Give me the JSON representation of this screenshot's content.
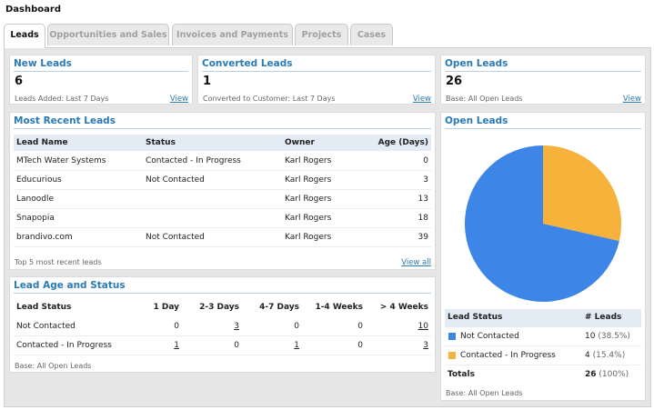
{
  "app": {
    "title": "Dashboard"
  },
  "tabs": [
    {
      "label": "Leads",
      "active": true
    },
    {
      "label": "Opportunities and Sales",
      "active": false
    },
    {
      "label": "Invoices and Payments",
      "active": false
    },
    {
      "label": "Projects",
      "active": false
    },
    {
      "label": "Cases",
      "active": false
    }
  ],
  "kpis": {
    "new_leads": {
      "title": "New Leads",
      "value": "6",
      "note": "Leads Added: Last 7 Days",
      "link": "View"
    },
    "converted_leads": {
      "title": "Converted Leads",
      "value": "1",
      "note": "Converted to Customer: Last 7 Days",
      "link": "View"
    },
    "open_leads": {
      "title": "Open Leads",
      "value": "26",
      "note": "Base: All Open Leads",
      "link": "View"
    }
  },
  "recent": {
    "title": "Most Recent Leads",
    "columns": {
      "name": "Lead Name",
      "status": "Status",
      "owner": "Owner",
      "age": "Age (Days)"
    },
    "rows": [
      {
        "name": "MTech Water Systems",
        "status": "Contacted - In Progress",
        "owner": "Karl Rogers",
        "age": "0"
      },
      {
        "name": "Educurious",
        "status": "Not Contacted",
        "owner": "Karl Rogers",
        "age": "3"
      },
      {
        "name": "Lanoodle",
        "status": "",
        "owner": "Karl Rogers",
        "age": "13"
      },
      {
        "name": "Snapopia",
        "status": "",
        "owner": "Karl Rogers",
        "age": "18"
      },
      {
        "name": "brandivo.com",
        "status": "Not Contacted",
        "owner": "Karl Rogers",
        "age": "39"
      }
    ],
    "footer": "Top 5 most recent leads",
    "link": "View all"
  },
  "age_status": {
    "title": "Lead Age and Status",
    "columns": {
      "status": "Lead Status",
      "d1": "1 Day",
      "d23": "2-3 Days",
      "d47": "4-7 Days",
      "w14": "1-4 Weeks",
      "w4p": "> 4 Weeks"
    },
    "rows": [
      {
        "status": "Not Contacted",
        "d1": "0",
        "d23": "3",
        "d47": "0",
        "w14": "0",
        "w4p": "10"
      },
      {
        "status": "Contacted - In Progress",
        "d1": "1",
        "d23": "0",
        "d47": "1",
        "w14": "0",
        "w4p": "3"
      }
    ],
    "footer": "Base: All Open Leads"
  },
  "open_leads_chart": {
    "title": "Open Leads",
    "columns": {
      "status": "Lead Status",
      "count": "# Leads"
    },
    "rows": [
      {
        "label": "Not Contacted",
        "count": "10",
        "pct": "(38.5%)",
        "color": "#3d86e8"
      },
      {
        "label": "Contacted - In Progress",
        "count": "4",
        "pct": "(15.4%)",
        "color": "#f7b23b"
      }
    ],
    "total": {
      "label": "Totals",
      "count": "26",
      "pct": "(100%)"
    },
    "footer": "Base: All Open Leads"
  },
  "chart_data": {
    "type": "pie",
    "categories": [
      "Not Contacted",
      "Contacted - In Progress"
    ],
    "values": [
      10,
      4
    ],
    "colors": [
      "#3d86e8",
      "#f7b23b"
    ],
    "title": "Open Leads"
  }
}
